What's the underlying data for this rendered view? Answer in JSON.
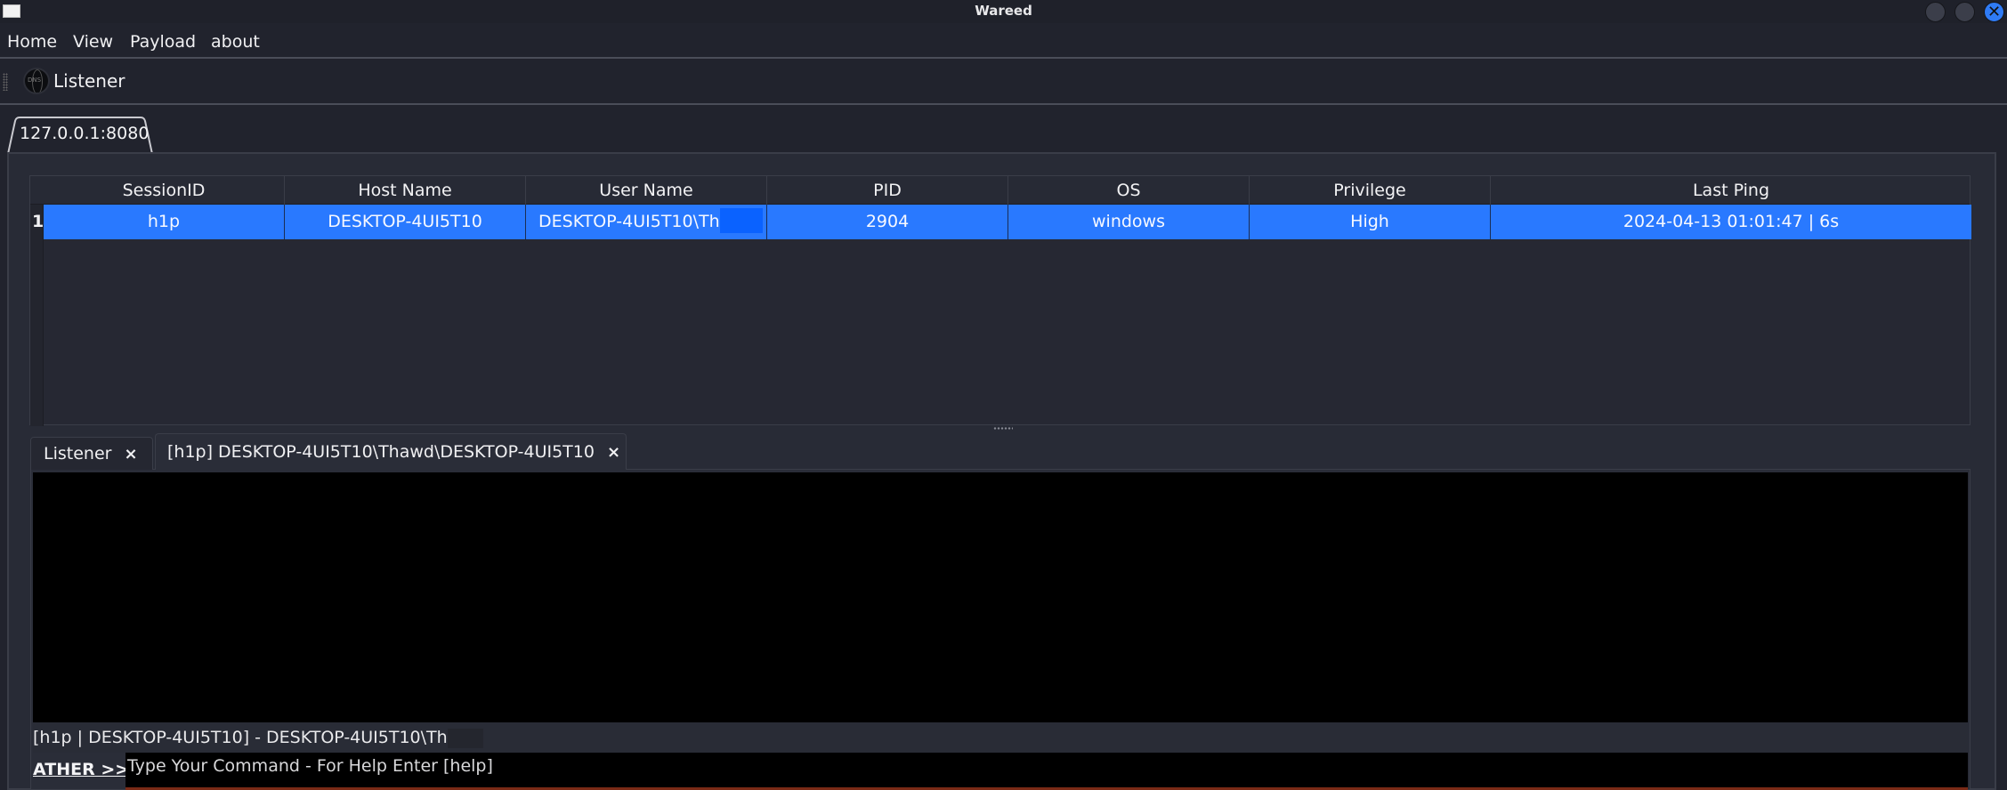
{
  "window": {
    "title": "Wareed",
    "controls": [
      "minimize",
      "maximize",
      "close"
    ],
    "accent_color": "#2979ff"
  },
  "menubar": {
    "items": [
      "Home",
      "View",
      "Payload",
      "about"
    ]
  },
  "toolbar": {
    "listener_label": "Listener",
    "listener_icon": "globe-dns-icon"
  },
  "listener_tab": {
    "label": "127.0.0.1:8080"
  },
  "sessions_table": {
    "columns": [
      "SessionID",
      "Host Name",
      "User Name",
      "PID",
      "OS",
      "Privilege",
      "Last Ping"
    ],
    "rows": [
      {
        "index": "1",
        "session_id": "h1p",
        "host_name": "DESKTOP-4UI5T10",
        "user_name": "DESKTOP-4UI5T10\\Th",
        "pid": "2904",
        "os": "windows",
        "privilege": "High",
        "last_ping": "2024-04-13 01:01:47 | 6s",
        "selected": true
      }
    ]
  },
  "bottom_tabs": [
    {
      "label": "Listener",
      "close": "×",
      "active": false
    },
    {
      "label": "[h1p] DESKTOP-4UI5T10\\Thawd\\DESKTOP-4UI5T10",
      "close": "×",
      "active": true
    }
  ],
  "console": {
    "output": "",
    "status_line": "[h1p | DESKTOP-4UI5T10] - DESKTOP-4UI5T10\\Th",
    "prompt_label": "ATHER >>",
    "command_placeholder": "Type Your Command - For Help Enter [help]",
    "command_value": ""
  }
}
